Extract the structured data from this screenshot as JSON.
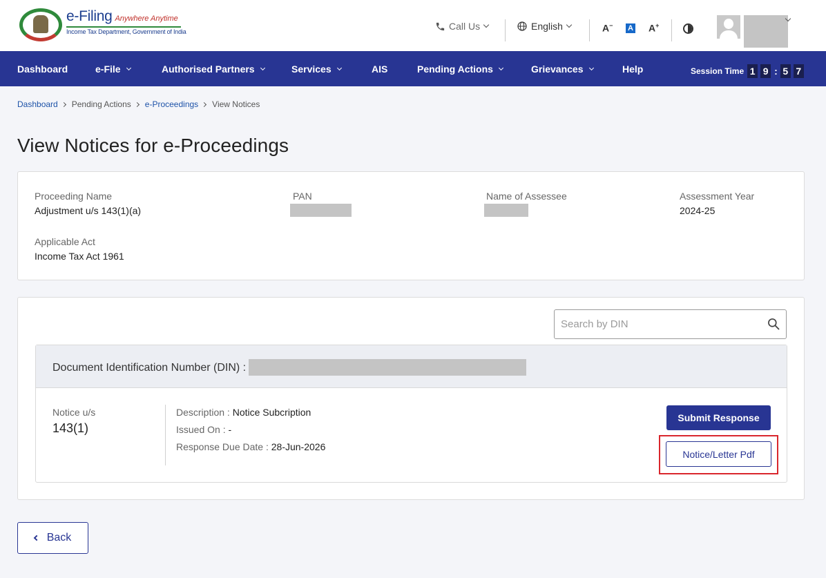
{
  "header": {
    "logo": {
      "title": "e-Filing",
      "tagline": "Anywhere Anytime",
      "subtitle": "Income Tax Department, Government of India"
    },
    "call_us": "Call Us",
    "language": "English",
    "font_decrease": "A",
    "font_normal": "A",
    "font_increase": "A"
  },
  "nav": {
    "items": [
      {
        "label": "Dashboard"
      },
      {
        "label": "e-File"
      },
      {
        "label": "Authorised Partners"
      },
      {
        "label": "Services"
      },
      {
        "label": "AIS"
      },
      {
        "label": "Pending Actions"
      },
      {
        "label": "Grievances"
      },
      {
        "label": "Help"
      }
    ],
    "session_label": "Session Time",
    "session_digits": [
      "1",
      "9",
      "5",
      "7"
    ],
    "session_colon": ":"
  },
  "breadcrumb": {
    "items": [
      "Dashboard",
      "Pending Actions",
      "e-Proceedings",
      "View Notices"
    ]
  },
  "page_title": "View Notices for e-Proceedings",
  "info": {
    "proceeding_name_label": "Proceeding Name",
    "proceeding_name_value": "Adjustment u/s 143(1)(a)",
    "pan_label": "PAN",
    "assessee_label": "Name of Assessee",
    "assessment_year_label": "Assessment Year",
    "assessment_year_value": "2024-25",
    "applicable_act_label": "Applicable Act",
    "applicable_act_value": "Income Tax Act 1961"
  },
  "search": {
    "placeholder": "Search by DIN"
  },
  "notice": {
    "din_label": "Document Identification Number (DIN) :",
    "notice_us_label": "Notice u/s",
    "notice_us_value": "143(1)",
    "description_label": "Description : ",
    "description_value": "Notice Subcription",
    "issued_on_label": "Issued On : ",
    "issued_on_value": "-",
    "due_date_label": "Response Due Date : ",
    "due_date_value": "28-Jun-2026",
    "submit_label": "Submit Response",
    "pdf_label": "Notice/Letter Pdf"
  },
  "back_label": "Back"
}
